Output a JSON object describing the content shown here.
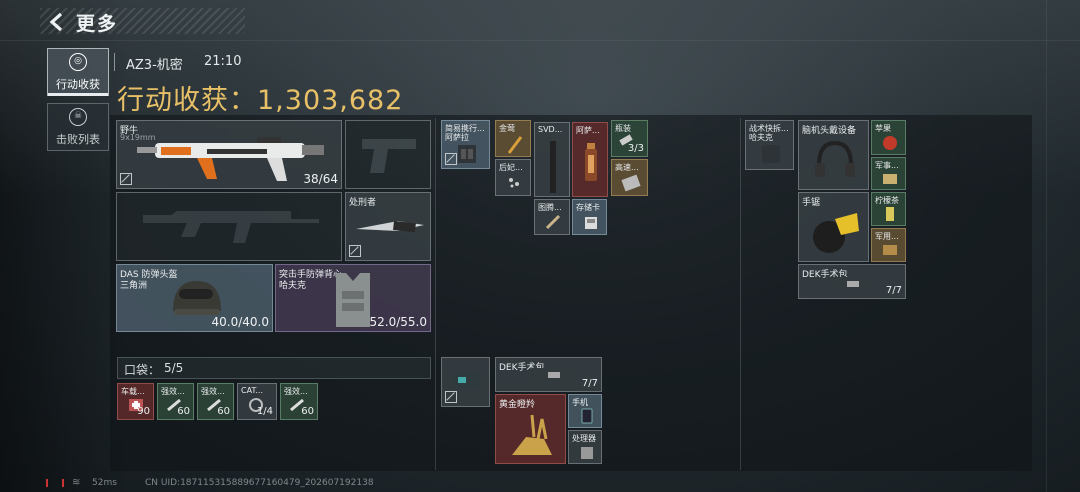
{
  "header": {
    "title": "更多"
  },
  "side_tabs": [
    {
      "label": "行动收获",
      "active": true
    },
    {
      "label": "击败列表",
      "active": false
    }
  ],
  "meta": {
    "map": "AZ3-机密",
    "time": "21:10"
  },
  "haul": {
    "label": "行动收获：",
    "value": "1,303,682"
  },
  "gear": {
    "primary": {
      "name": "野牛",
      "caliber": "9x19mm",
      "ammo": "38/64"
    },
    "pistol": {
      "name": ""
    },
    "rifle": {
      "name": ""
    },
    "melee": {
      "name": "处刑者"
    },
    "helmet": {
      "name": "DAS 防弹头盔",
      "sub": "三角洲",
      "durability": "40.0/40.0"
    },
    "vest": {
      "name": "突击手防弹背心",
      "sub": "哈夫克",
      "durability": "52.0/55.0"
    }
  },
  "pocket": {
    "label": "口袋：",
    "count": "5/5",
    "items": [
      {
        "name": "车载...",
        "qty": "90"
      },
      {
        "name": "强效...",
        "qty": "60"
      },
      {
        "name": "强效...",
        "qty": "60"
      },
      {
        "name": "CAT...",
        "qty": "1/4"
      },
      {
        "name": "强效...",
        "qty": "60"
      }
    ]
  },
  "chest_rig": {
    "items": [
      {
        "name": "简易携行...",
        "sub": "阿萨拉"
      },
      {
        "name": "金莺"
      },
      {
        "name": "SVD..."
      },
      {
        "name": "阿萨..."
      },
      {
        "name": "瓶装",
        "qty": "3/3"
      },
      {
        "name": "后妃..."
      },
      {
        "name": "高速..."
      },
      {
        "name": "图腾..."
      },
      {
        "name": "存储卡"
      }
    ]
  },
  "backpack_mid": {
    "items": [
      {
        "name": ""
      },
      {
        "name": "DEK手术包",
        "qty": "7/7"
      },
      {
        "name": "黄金瞪羚"
      },
      {
        "name": "手机"
      },
      {
        "name": "处理器"
      }
    ]
  },
  "backpack_right": {
    "items": [
      {
        "name": "战术快拆...",
        "sub": "哈夫克"
      },
      {
        "name": "脑机头戴设备"
      },
      {
        "name": "苹果"
      },
      {
        "name": "军事..."
      },
      {
        "name": "手锯"
      },
      {
        "name": "柠檬茶"
      },
      {
        "name": "军用..."
      },
      {
        "name": "DEK手术包",
        "qty": "7/7"
      }
    ]
  },
  "footer": {
    "ping": "52ms",
    "uid": "CN UID:18711531588967716047​9_202607192138"
  },
  "colors": {
    "accent_gold": "#e7c067",
    "bg": "#1a2226"
  }
}
